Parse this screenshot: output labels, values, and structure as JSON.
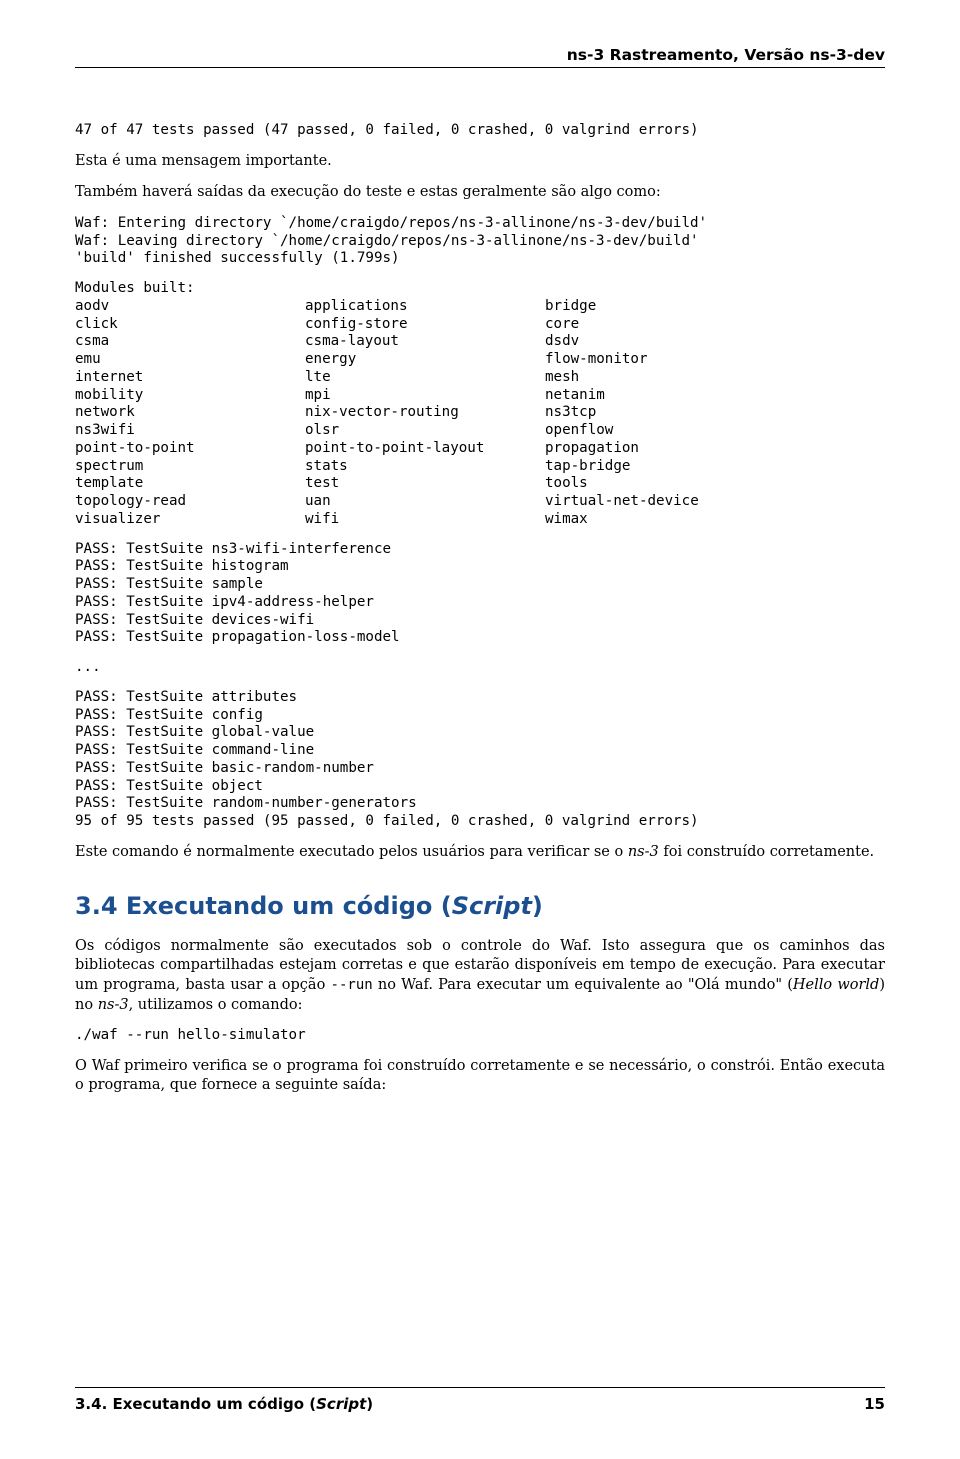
{
  "header": {
    "title": "ns-3 Rastreamento, Versão ns-3-dev"
  },
  "summary_line": "47 of 47 tests passed (47 passed, 0 failed, 0 crashed, 0 valgrind errors)",
  "para1": "Esta é uma mensagem importante.",
  "para2": "Também haverá saídas da execução do teste e estas geralmente são algo como:",
  "waf_output": "Waf: Entering directory `/home/craigdo/repos/ns-3-allinone/ns-3-dev/build'\nWaf: Leaving directory `/home/craigdo/repos/ns-3-allinone/ns-3-dev/build'\n'build' finished successfully (1.799s)",
  "modules_label": "Modules built:",
  "modules": {
    "col1": [
      "aodv",
      "click",
      "csma",
      "emu",
      "internet",
      "mobility",
      "network",
      "ns3wifi",
      "point-to-point",
      "spectrum",
      "template",
      "topology-read",
      "visualizer"
    ],
    "col2": [
      "applications",
      "config-store",
      "csma-layout",
      "energy",
      "lte",
      "mpi",
      "nix-vector-routing",
      "olsr",
      "point-to-point-layout",
      "stats",
      "test",
      "uan",
      "wifi"
    ],
    "col3": [
      "bridge",
      "core",
      "dsdv",
      "flow-monitor",
      "mesh",
      "netanim",
      "ns3tcp",
      "openflow",
      "propagation",
      "tap-bridge",
      "tools",
      "virtual-net-device",
      "wimax"
    ]
  },
  "pass_block1": "PASS: TestSuite ns3-wifi-interference\nPASS: TestSuite histogram\nPASS: TestSuite sample\nPASS: TestSuite ipv4-address-helper\nPASS: TestSuite devices-wifi\nPASS: TestSuite propagation-loss-model",
  "ellipsis": "...",
  "pass_block2": "PASS: TestSuite attributes\nPASS: TestSuite config\nPASS: TestSuite global-value\nPASS: TestSuite command-line\nPASS: TestSuite basic-random-number\nPASS: TestSuite object\nPASS: TestSuite random-number-generators\n95 of 95 tests passed (95 passed, 0 failed, 0 crashed, 0 valgrind errors)",
  "para3_pre": "Este comando é normalmente executado pelos usuários para verificar se o ",
  "para3_ital": "ns-3",
  "para3_post": " foi construído corretamente.",
  "section": {
    "number": "3.4",
    "title_plain": "Executando um código (",
    "title_ital": "Script",
    "title_close": ")"
  },
  "para4_a": "Os códigos normalmente são executados sob o controle do Waf. Isto assegura que os caminhos das bibliotecas compartilhadas estejam corretas e que estarão disponíveis em tempo de execução. Para executar um programa, basta usar a opção ",
  "para4_code": "--run",
  "para4_b": " no Waf. Para executar um equivalente ao \"Olá mundo\" (",
  "para4_ital": "Hello world",
  "para4_c": ") no ",
  "para4_ital2": "ns-3",
  "para4_d": ", utilizamos o comando:",
  "cmd": "./waf --run hello-simulator",
  "para5": "O Waf primeiro verifica se o programa foi construído corretamente e se necessário, o constrói. Então executa o programa, que fornece a seguinte saída:",
  "footer": {
    "left_prefix": "3.4. Executando um código (",
    "left_ital": "Script",
    "left_suffix": ")",
    "page": "15"
  }
}
